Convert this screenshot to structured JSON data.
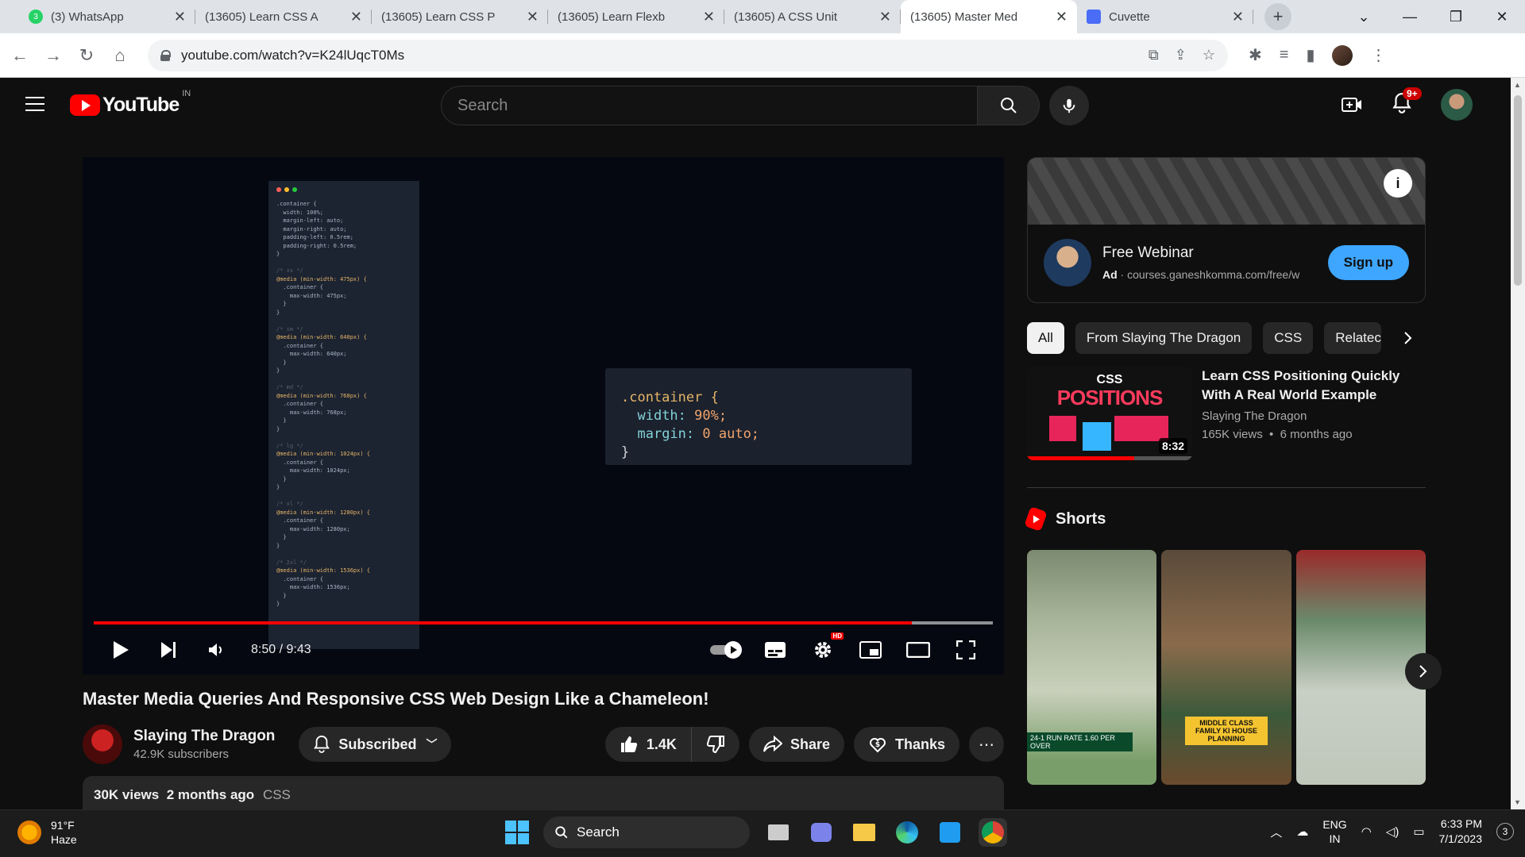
{
  "browser": {
    "tabs": [
      {
        "label": "(3) WhatsApp",
        "type": "whatsapp",
        "active": false
      },
      {
        "label": "(13605) Learn CSS A",
        "type": "youtube",
        "active": false
      },
      {
        "label": "(13605) Learn CSS P",
        "type": "youtube",
        "active": false
      },
      {
        "label": "(13605) Learn Flexb",
        "type": "youtube",
        "active": false
      },
      {
        "label": "(13605) A CSS Unit",
        "type": "youtube",
        "active": false
      },
      {
        "label": "(13605) Master Med",
        "type": "youtube",
        "active": true
      },
      {
        "label": "Cuvette",
        "type": "cuvette",
        "active": false
      }
    ],
    "whatsapp_badge": "3",
    "url": "youtube.com/watch?v=K24lUqcT0Ms"
  },
  "youtube": {
    "logo_text": "YouTube",
    "country_code": "IN",
    "search_placeholder": "Search",
    "notification_count": "9+"
  },
  "player": {
    "time_current": "8:50",
    "time_total": "9:43",
    "time_display": "8:50 / 9:43",
    "progress_fraction": 0.91,
    "buffered_fraction": 1.0,
    "hd_badge": "HD",
    "code_snippet": {
      "selector": ".container {",
      "line1_prop": "width:",
      "line1_val": "90%;",
      "line2_prop": "margin:",
      "line2_val": "0 auto;",
      "close": "}"
    },
    "side_code_lines": [
      ".container {",
      "  width: 100%;",
      "  margin-left: auto;",
      "  margin-right: auto;",
      "  padding-left: 0.5rem;",
      "  padding-right: 0.5rem;",
      "}",
      "",
      "/* xs */",
      "@media (min-width: 475px) {",
      "  .container {",
      "    max-width: 475px;",
      "  }",
      "}",
      "",
      "/* sm */",
      "@media (min-width: 640px) {",
      "  .container {",
      "    max-width: 640px;",
      "  }",
      "}",
      "",
      "/* md */",
      "@media (min-width: 768px) {",
      "  .container {",
      "    max-width: 768px;",
      "  }",
      "}",
      "",
      "/* lg */",
      "@media (min-width: 1024px) {",
      "  .container {",
      "    max-width: 1024px;",
      "  }",
      "}",
      "",
      "/* xl */",
      "@media (min-width: 1280px) {",
      "  .container {",
      "    max-width: 1280px;",
      "  }",
      "}",
      "",
      "/* 2xl */",
      "@media (min-width: 1536px) {",
      "  .container {",
      "    max-width: 1536px;",
      "  }",
      "}"
    ]
  },
  "video": {
    "title": "Master Media Queries And Responsive CSS Web Design Like a Chameleon!",
    "channel_name": "Slaying The Dragon",
    "subscribers": "42.9K subscribers",
    "subscribed_label": "Subscribed",
    "likes": "1.4K",
    "share_label": "Share",
    "thanks_label": "Thanks",
    "views": "30K views",
    "age": "2 months ago",
    "tag": "CSS"
  },
  "ad": {
    "title": "Free Webinar",
    "ad_label": "Ad",
    "url": "courses.ganeshkomma.com/free/w",
    "cta": "Sign up"
  },
  "chips": [
    "All",
    "From Slaying The Dragon",
    "CSS",
    "Relatec"
  ],
  "recommended": [
    {
      "title": "Learn CSS Positioning Quickly With A Real World Example",
      "channel": "Slaying The Dragon",
      "views": "165K views",
      "age": "6 months ago",
      "duration": "8:32",
      "watched_fraction": 0.65,
      "thumb_line1": "CSS",
      "thumb_line2": "POSITIONS"
    }
  ],
  "shorts": {
    "heading": "Shorts",
    "items": [
      {
        "caption": "24-1  RUN RATE 1.60 PER OVER"
      },
      {
        "caption": "MIDDLE CLASS FAMILY KI HOUSE PLANNING"
      },
      {
        "caption": ""
      }
    ]
  },
  "taskbar": {
    "temperature": "91°F",
    "condition": "Haze",
    "search_label": "Search",
    "lang_top": "ENG",
    "lang_bottom": "IN",
    "time": "6:33 PM",
    "date": "7/1/2023",
    "notification_count": "3"
  },
  "colors": {
    "yt_red": "#ff0000",
    "signup_blue": "#3ea6ff",
    "bg": "#0f0f0f"
  }
}
